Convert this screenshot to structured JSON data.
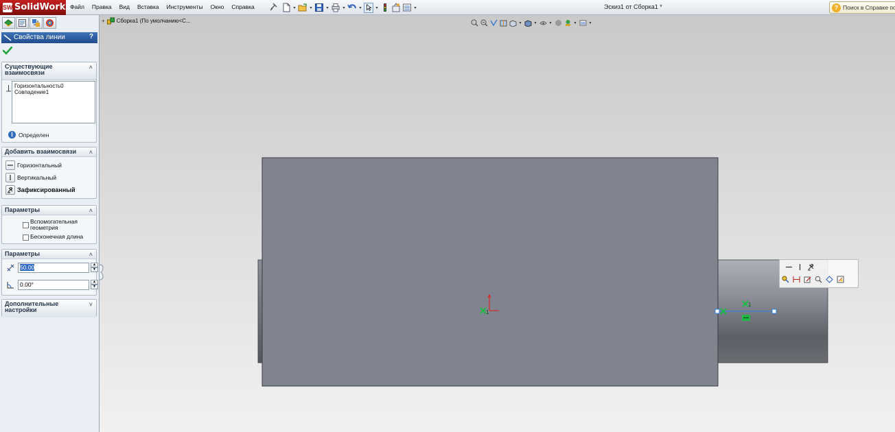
{
  "app": {
    "name": "SolidWorks",
    "logo_mark": "SW",
    "document_title": "Эскиз1 от Сборка1 *"
  },
  "menu": {
    "items": [
      "Файл",
      "Правка",
      "Вид",
      "Вставка",
      "Инструменты",
      "Окно",
      "Справка"
    ]
  },
  "help_search": {
    "icon": "question-icon",
    "placeholder": "Поиск в Справке по"
  },
  "toolbar": {
    "icons": [
      "new-document-icon",
      "open-icon",
      "save-icon",
      "print-icon",
      "undo-icon",
      "select-icon",
      "rebuild-icon",
      "options-icon",
      "customize-icon"
    ]
  },
  "property_manager": {
    "tabs": [
      "feature-manager-icon",
      "property-manager-icon",
      "configuration-manager-icon",
      "display-manager-icon"
    ],
    "title": "Свойства линии",
    "help_label": "?",
    "existing_relations": {
      "title": "Существующие взаимосвязи",
      "items": [
        "Горизонтальность0",
        "Совпадение1"
      ],
      "status": "Определен"
    },
    "add_relations": {
      "title": "Добавить взаимосвязи",
      "items": [
        {
          "label": "Горизонтальный",
          "icon": "horizontal-relation-icon"
        },
        {
          "label": "Вертикальный",
          "icon": "vertical-relation-icon"
        },
        {
          "label": "Зафиксированный",
          "icon": "fix-relation-icon"
        }
      ]
    },
    "options": {
      "title": "Параметры",
      "construction_geometry": "Вспомогательная геометрия",
      "construction_checked": false,
      "infinite_length": "Бесконечная длина",
      "infinite_checked": false
    },
    "parameters": {
      "title": "Параметры",
      "length": "50.00",
      "angle": "0.00°"
    },
    "additional": {
      "title": "Дополнительные настройки"
    }
  },
  "viewport": {
    "tree_label": "Сборка1  (По умолчанию<С...",
    "origin_label": "1",
    "relation_marker": "1"
  },
  "colors": {
    "part_face": "#80848f",
    "sketch_line": "#2c7fe6",
    "relation_marker": "#1fb845",
    "axis_red": "#e02020",
    "accent": "#1f4c8c"
  }
}
